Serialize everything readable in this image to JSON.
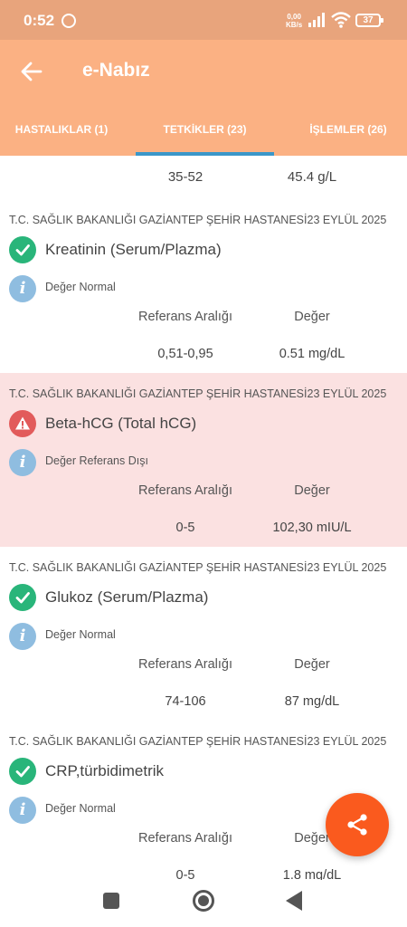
{
  "status_bar": {
    "time": "0:52",
    "speed_value": "0,00",
    "speed_unit": "KB/s",
    "battery": "37"
  },
  "app_bar": {
    "title": "e-Nabız",
    "back_icon": "arrow-left-icon"
  },
  "tabs": [
    {
      "label": "HASTALIKLAR (1)",
      "active": false
    },
    {
      "label": "TETKİKLER (23)",
      "active": true
    },
    {
      "label": "İŞLEMLER (26)",
      "active": false
    }
  ],
  "partial_row": {
    "reference": "35-52",
    "value": "45.4 g/L"
  },
  "labels": {
    "reference_header": "Referans Aralığı",
    "value_header": "Değer"
  },
  "results": [
    {
      "hospital": "T.C. SAĞLIK BAKANLIĞI GAZİANTEP ŞEHİR HASTANESİ23 EYLÜL 2025",
      "test": "Kreatinin (Serum/Plazma)",
      "status": "Değer Normal",
      "status_icon": "check-icon",
      "reference": "0,51-0,95",
      "value": "0.51 mg/dL"
    },
    {
      "hospital": "T.C. SAĞLIK BAKANLIĞI GAZİANTEP ŞEHİR HASTANESİ23 EYLÜL 2025",
      "test": "Beta-hCG (Total hCG)",
      "status": "Değer Referans Dışı",
      "status_icon": "warning-icon",
      "reference": "0-5",
      "value": "102,30 mIU/L"
    },
    {
      "hospital": "T.C. SAĞLIK BAKANLIĞI GAZİANTEP ŞEHİR HASTANESİ23 EYLÜL 2025",
      "test": "Glukoz (Serum/Plazma)",
      "status": "Değer Normal",
      "status_icon": "check-icon",
      "reference": "74-106",
      "value": "87 mg/dL"
    },
    {
      "hospital": "T.C. SAĞLIK BAKANLIĞI GAZİANTEP ŞEHİR HASTANESİ23 EYLÜL 2025",
      "test": "CRP,türbidimetrik",
      "status": "Değer Normal",
      "status_icon": "check-icon",
      "reference": "0-5",
      "value": "1.8 mg/dL"
    }
  ],
  "colors": {
    "app_bar": "#fbb183",
    "status_bar": "#e8a47c",
    "tab_indicator": "#3b97c9",
    "ok": "#29b57a",
    "warning": "#e25b5b",
    "alert_background": "#fbe1e1",
    "info": "#8fbde0",
    "fab": "#fa5a1e"
  },
  "fab": {
    "icon": "share-icon"
  }
}
